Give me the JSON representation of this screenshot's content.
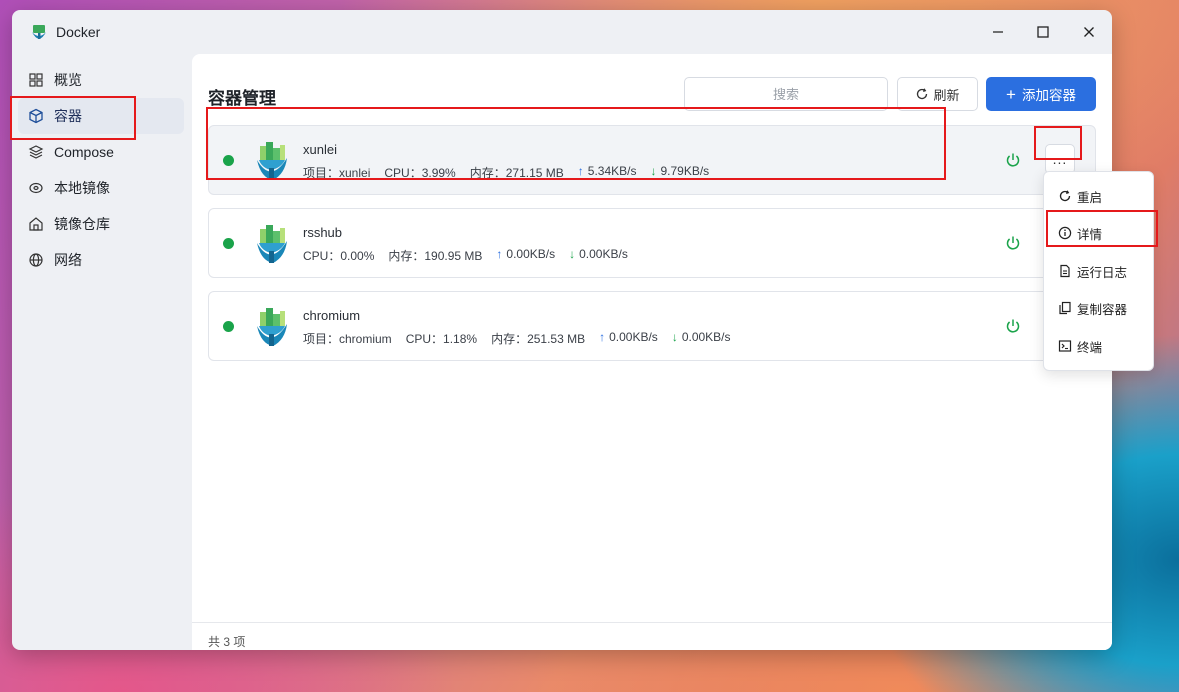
{
  "window": {
    "title": "Docker",
    "controls": [
      "minimize",
      "maximize",
      "close"
    ]
  },
  "sidebar": {
    "items": [
      {
        "label": "概览",
        "icon": "grid-icon"
      },
      {
        "label": "容器",
        "icon": "cube-icon",
        "active": true
      },
      {
        "label": "Compose",
        "icon": "layers-icon"
      },
      {
        "label": "本地镜像",
        "icon": "disk-icon"
      },
      {
        "label": "镜像仓库",
        "icon": "warehouse-icon"
      },
      {
        "label": "网络",
        "icon": "globe-icon"
      }
    ]
  },
  "main": {
    "title": "容器管理",
    "search_placeholder": "搜索",
    "refresh_label": "刷新",
    "add_label": "添加容器",
    "footer": "共 3 项"
  },
  "containers": [
    {
      "name": "xunlei",
      "project": "项目：xunlei",
      "cpu": "CPU：3.99%",
      "mem": "内存：271.15 MB",
      "up": "5.34KB/s",
      "down": "9.79KB/s",
      "status": "running"
    },
    {
      "name": "rsshub",
      "project": "",
      "cpu": "CPU：0.00%",
      "mem": "内存：190.95 MB",
      "up": "0.00KB/s",
      "down": "0.00KB/s",
      "status": "running"
    },
    {
      "name": "chromium",
      "project": "项目：chromium",
      "cpu": "CPU：1.18%",
      "mem": "内存：251.53 MB",
      "up": "0.00KB/s",
      "down": "0.00KB/s",
      "status": "running"
    }
  ],
  "context_menu": {
    "items": [
      {
        "label": "重启",
        "icon": "restart-icon"
      },
      {
        "label": "详情",
        "icon": "info-icon"
      },
      {
        "label": "运行日志",
        "icon": "log-icon"
      },
      {
        "label": "复制容器",
        "icon": "copy-icon"
      },
      {
        "label": "终端",
        "icon": "terminal-icon"
      }
    ]
  },
  "colors": {
    "accent": "#2b6fe0",
    "running": "#1aa34a",
    "highlight": "#e5191b"
  },
  "more_label": "..."
}
